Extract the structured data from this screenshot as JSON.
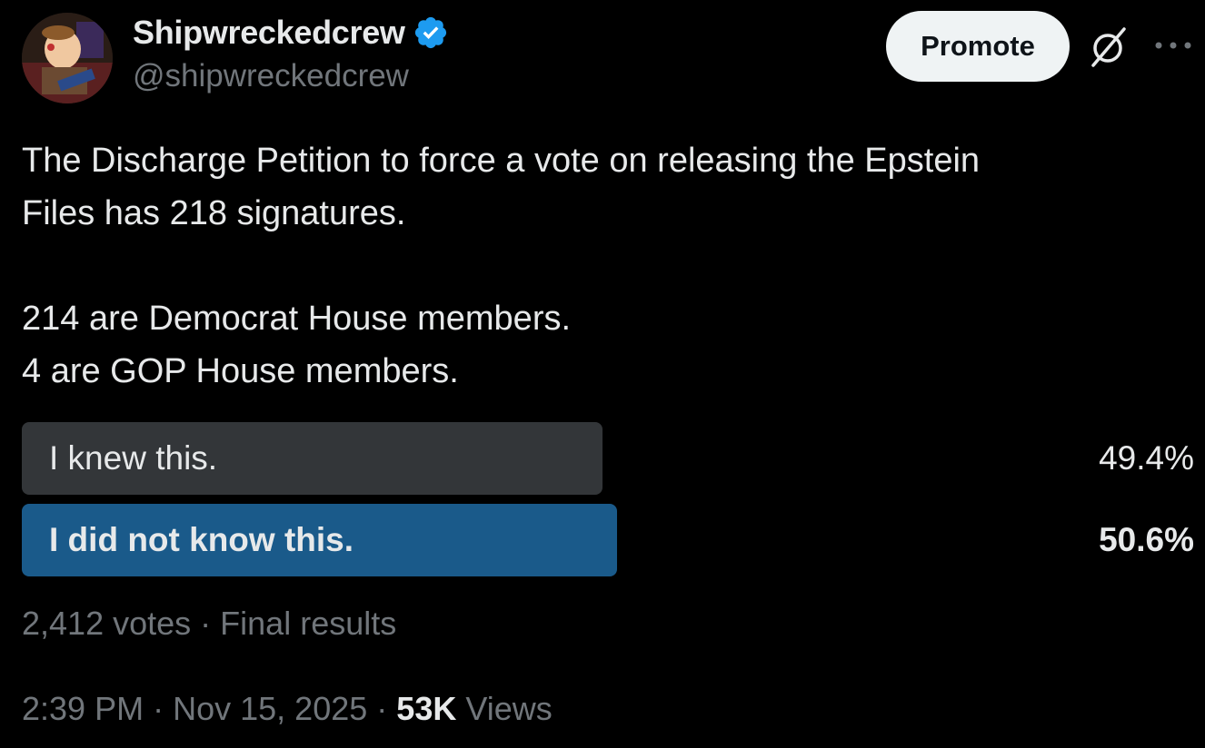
{
  "author": {
    "display_name": "Shipwreckedcrew",
    "handle": "@shipwreckedcrew",
    "verified": true,
    "avatar_icon": "cartoon-character-avatar"
  },
  "header_actions": {
    "promote_label": "Promote",
    "grok_icon": "slashed-circle-icon",
    "more_icon": "ellipsis-icon"
  },
  "tweet": {
    "lines": [
      "The Discharge Petition to force a vote on releasing the Epstein",
      "Files has 218 signatures.",
      "",
      "214 are Democrat House members.",
      "4 are GOP House members."
    ]
  },
  "poll": {
    "options": [
      {
        "label": "I knew this.",
        "percent_text": "49.4%",
        "percent": 49.4,
        "winner": false
      },
      {
        "label": "I did not know this.",
        "percent_text": "50.6%",
        "percent": 50.6,
        "winner": true
      }
    ],
    "votes": "2,412 votes",
    "separator": "·",
    "status": "Final results"
  },
  "meta": {
    "time": "2:39 PM",
    "separator": "·",
    "date": "Nov 15, 2025",
    "views_count": "53K",
    "views_label": "Views"
  },
  "colors": {
    "background": "#000000",
    "text_primary": "#e7e9ea",
    "text_secondary": "#71767b",
    "verified_blue": "#1d9bf0",
    "poll_bar_loser": "#333639",
    "poll_bar_winner": "#1a5a8a",
    "button_bg": "#eff3f4"
  }
}
